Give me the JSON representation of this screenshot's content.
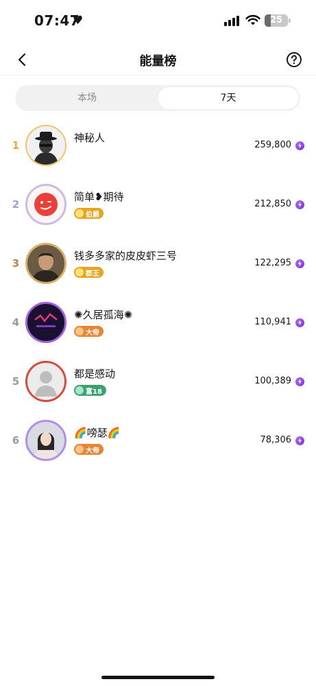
{
  "status_bar": {
    "time": "07:47",
    "heart": "♥",
    "battery_level": "25"
  },
  "header": {
    "title": "能量榜"
  },
  "tabs": [
    {
      "label": "本场",
      "active": false
    },
    {
      "label": "7天",
      "active": true
    }
  ],
  "colors": {
    "rank_gold": "#e6a93c",
    "rank_silver": "#9f9fd6",
    "rank_bronze": "#c5804a",
    "rank_other": "#9a9a9a",
    "badge_gold": "#e7a41f",
    "badge_orange": "#ee8231",
    "badge_green": "#3d9f74",
    "energy_purple": "#8a3cf0"
  },
  "leaderboard": [
    {
      "rank": "1",
      "name": "神秘人",
      "badge": "",
      "score": "259,800",
      "avatar_icon": "mystery-person-avatar-icon"
    },
    {
      "rank": "2",
      "name": "简单❥期待",
      "badge": "伯爵",
      "score": "212,850",
      "avatar_icon": "red-face-avatar-icon"
    },
    {
      "rank": "3",
      "name": "钱多多家的皮皮虾三号",
      "badge": "郡王",
      "score": "122,295",
      "avatar_icon": "man-photo-avatar-icon"
    },
    {
      "rank": "4",
      "name": "✺久居孤海✺",
      "badge": "大帝",
      "score": "110,941",
      "avatar_icon": "neon-night-avatar-icon"
    },
    {
      "rank": "5",
      "name": "都是感动",
      "badge": "富18",
      "score": "100,389",
      "avatar_icon": "default-silhouette-avatar-icon"
    },
    {
      "rank": "6",
      "name": "🌈嗙瑟🌈",
      "badge": "大帝",
      "score": "78,306",
      "avatar_icon": "woman-photo-avatar-icon"
    }
  ]
}
